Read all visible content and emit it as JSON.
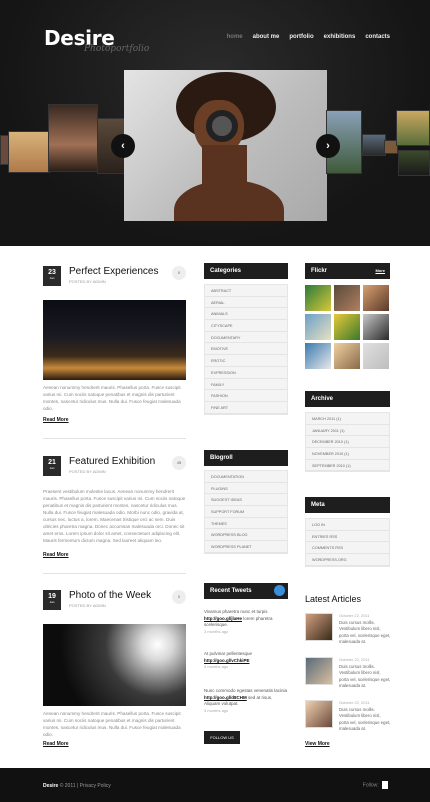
{
  "header": {
    "logo": "Desire",
    "tagline": "Photoportfolio",
    "nav": [
      "home",
      "about me",
      "portfolio",
      "exhibitions",
      "contacts"
    ],
    "active_nav": "home"
  },
  "slider": {
    "prev_label": "‹",
    "next_label": "›"
  },
  "posts": [
    {
      "day": "23",
      "month": "Jan",
      "title": "Perfect Experiences",
      "meta": "POSTED BY ADMIN",
      "comments": "0",
      "text": "Aenean nonummy hendrerit mauris. Phasellus porta. Fusce suscipit varius mi. Cum sociis natoque penatibus et magnis dis parturient montes, nascetur ridiculus mus. Nulla dui. Fusce feugiat malesuada odio.",
      "read_more": "Read More"
    },
    {
      "day": "21",
      "month": "Jan",
      "title": "Featured Exhibition",
      "meta": "POSTED BY ADMIN",
      "comments": "45",
      "text": "Praesent vestibulum molestie lacus. Aenean nonummy hendrerit mauris. Phasellus porta. Fusce suscipit varius mi. Cum sociis natoque penatibus et magnis dis parturient montes, nascetur ridiculus mus. Nulla dui. Fusce feugiat malesuada odio. Morbi nunc odio, gravida at, cursus nec, luctus a, lorem. Maecenas tristique orci ac sem. Duis ultricies pharetra magna. Donec accumsan malesuada orci. Donec sit amet eros. Lorem ipsum dolor sit amet, consectetuer adipiscing elit. Mauris fermentum dictum magna. Sed laoreet aliquam leo.",
      "read_more": "Read More"
    },
    {
      "day": "19",
      "month": "Jan",
      "title": "Photo of the Week",
      "meta": "POSTED BY ADMIN",
      "comments": "0",
      "text": "Aenean nonummy hendrerit mauris. Phasellus porta. Fusce suscipit varius mi. Cum sociis natoque penatibus et magnis dis parturient montes, nascetur ridiculus mus. Nulla dui. Fusce feugiat malesuada odio.",
      "read_more": "Read More"
    }
  ],
  "categories": {
    "title": "Categories",
    "items": [
      "ABSTRACT",
      "AERIAL",
      "ANIMALS",
      "CITYSCAPE",
      "DOCUMENTARY",
      "EMOTIVE",
      "EROTIC",
      "EXPRESSION",
      "FAMILY",
      "FASHION",
      "FINE ART"
    ]
  },
  "blogroll": {
    "title": "Blogroll",
    "items": [
      "DOCUMENTATION",
      "PLUGINS",
      "SUGGEST IDEAS",
      "SUPPORT FORUM",
      "THEMES",
      "WORDPRESS BLOG",
      "WORDPRESS PLANET"
    ]
  },
  "tweets": {
    "title": "Recent Tweets",
    "items": [
      {
        "text": "Vivamus pharetra nunc et turpis",
        "link": "http://goo.gl/jlaHe",
        "after": "lorem pharetra scelerisque.",
        "ago": "3 months ago"
      },
      {
        "text": "At pulvinar pellentesque",
        "link": "http://goo.gl/vChkiPE",
        "after": "",
        "ago": "3 months ago"
      },
      {
        "text": "Nunc commodo egestas venenatis lacinia",
        "link": "http://goo.gl/d8CHM",
        "after": "sed at risus. Aliquam volutpat.",
        "ago": "3 months ago"
      }
    ],
    "follow_label": "FOLLOW US"
  },
  "flickr": {
    "title": "Flickr",
    "more": "More"
  },
  "archive": {
    "title": "Archive",
    "items": [
      "MARCH 2011 (1)",
      "JANUARY 2011 (1)",
      "DECEMBER 2010 (1)",
      "NOVEMBER 2010 (1)",
      "SEPTEMBER 2010 (1)"
    ]
  },
  "meta": {
    "title": "Meta",
    "items": [
      "LOG IN",
      "ENTRIES RSS",
      "COMMENTS RSS",
      "WORDPRESS.ORG"
    ]
  },
  "latest": {
    "title": "Latest Articles",
    "items": [
      {
        "date": "October 22, 2011",
        "text": "Duis cursus mollis. Vestibulum libero nisl, porta vel, scelerisque eget, malesuada at."
      },
      {
        "date": "October 22, 2011",
        "text": "Duis cursus mollis. Vestibulum libero nisl, porta vel, scelerisque eget, malesuada at."
      },
      {
        "date": "October 22, 2011",
        "text": "Duis cursus mollis. Vestibulum libero nisl, porta vel, scelerisque eget, malesuada at."
      }
    ],
    "view_more": "View More"
  },
  "footer": {
    "brand": "Desire",
    "copyright": "© 2011 | Privacy Policy",
    "follow": "Follow:"
  }
}
